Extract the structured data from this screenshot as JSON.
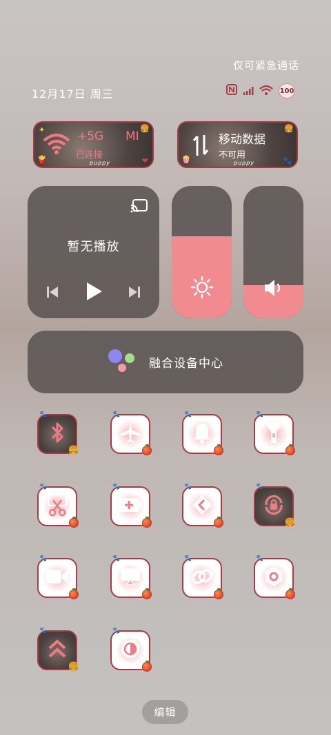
{
  "status": {
    "emergency_only": "仅可紧急通话",
    "date": "12月17日 周三",
    "battery": "100"
  },
  "wifi_card": {
    "title": "+5G",
    "title_suffix": "MI",
    "subtitle": "已连接",
    "caption": "puppy"
  },
  "data_card": {
    "title": "移动数据",
    "subtitle": "不可用",
    "caption": "puppy"
  },
  "media": {
    "title": "暂无播放"
  },
  "brightness_level": 0.62,
  "volume_level": 0.25,
  "fusion": {
    "label": "融合设备中心"
  },
  "tiles": [
    {
      "name": "bluetooth"
    },
    {
      "name": "airplane-mode"
    },
    {
      "name": "notification-sound"
    },
    {
      "name": "flashlight"
    },
    {
      "name": "screenshot"
    },
    {
      "name": "battery-saver"
    },
    {
      "name": "cast"
    },
    {
      "name": "rotation-lock"
    },
    {
      "name": "screen-record"
    },
    {
      "name": "screen-mirror"
    },
    {
      "name": "link"
    },
    {
      "name": "settings"
    },
    {
      "name": "signal-boost"
    },
    {
      "name": "dark-mode"
    }
  ],
  "edit": {
    "label": "编辑"
  },
  "colors": {
    "accent": "#f28b90",
    "border": "#a83a44",
    "panel": "#5f5856"
  }
}
